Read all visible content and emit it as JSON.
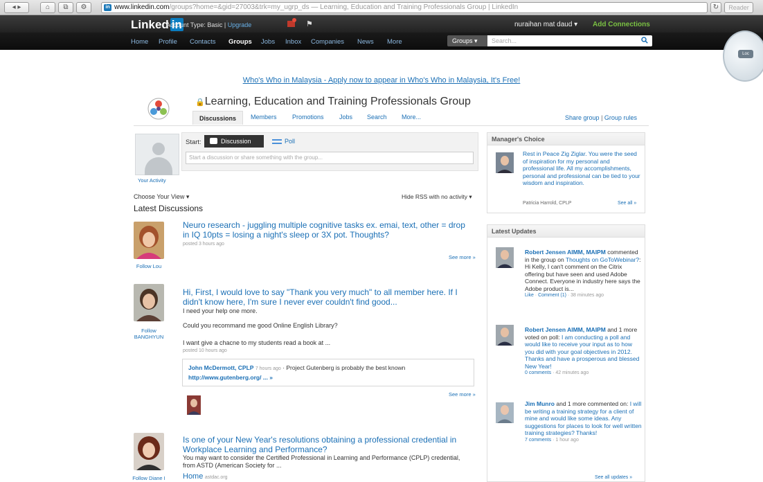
{
  "browser": {
    "url_domain": "www.linkedin.com",
    "url_rest": "/groups?home=&gid=27003&trk=my_ugrp_ds — Learning, Education and Training Professionals Group | LinkedIn",
    "reader_label": "Reader"
  },
  "header": {
    "logo_text": "Linked",
    "logo_in": "in",
    "account_type": "Account Type: Basic",
    "upgrade": "Upgrade",
    "user_name": "nuraihan mat daud ▾",
    "add_connections": "Add Connections",
    "nav": [
      "Home",
      "Profile",
      "Contacts",
      "Groups",
      "Jobs",
      "Inbox",
      "Companies",
      "News",
      "More"
    ],
    "search_scope": "Groups ▾",
    "search_placeholder": "Search..."
  },
  "magnifier_label": "Loc",
  "promo": "Who's Who in Malaysia - Apply now to appear in Who's Who in Malaysia, It's Free!",
  "group": {
    "title": "Learning, Education and Training Professionals Group",
    "tabs": [
      "Discussions",
      "Members",
      "Promotions",
      "Jobs",
      "Search",
      "More..."
    ],
    "share": "Share group",
    "rules": "Group rules"
  },
  "composer": {
    "your_activity": "Your Activity",
    "start": "Start:",
    "discussion": "Discussion",
    "poll": "Poll",
    "placeholder": "Start a discussion or share something with the group..."
  },
  "list": {
    "choose_view": "Choose Your View ▾",
    "hide_rss": "Hide RSS with no activity ▾",
    "heading": "Latest Discussions"
  },
  "discussions": [
    {
      "follow": "Follow Lou",
      "title": "Neuro research - juggling multiple cognitive tasks ex. emai, text, other = drop in IQ 10pts = losing a night's sleep or 3X pot. Thoughts?",
      "meta": "posted 3 hours ago",
      "see_more": "See more »"
    },
    {
      "follow": "Follow BANGHYUN",
      "title": "Hi, First, I would love to say \"Thank you very much\" to all member here. If I didn't know here, I'm sure I never ever couldn't find good...",
      "body1": "I need your help one more.",
      "body2": "Could you recommand me good Online English Library?",
      "body3": "I want give a chacne to my students read a book at ...",
      "meta": "posted 10 hours ago",
      "reply_author": "John McDermott, CPLP",
      "reply_time": "7 hours ago",
      "reply_text": "· Project Gutenberg is probably the best known",
      "reply_link": "http://www.gutenberg.org/ ... »",
      "see_more": "See more »"
    },
    {
      "follow": "Follow Diane I",
      "title": "Is one of your New Year's resolutions obtaining a professional credential in Workplace Learning and Performance?",
      "body1": "You may want to consider the Certified Professional in Learning and Performance (CPLP) credential, from ASTD (American Society for ...",
      "source_title": "Home",
      "source_site": "astdac.org"
    }
  ],
  "managers_choice": {
    "heading": "Manager's Choice",
    "text": "Rest in Peace Zig Ziglar. You were the seed of inspiration for my personal and professional life. All my accomplishments, personal and professional can be tied to your wisdom and inspiration.",
    "author": "Patricia Harrold, CPLP",
    "see_all": "See all »"
  },
  "updates": {
    "heading": "Latest Updates",
    "items": [
      {
        "name": "Robert Jensen AIMM, MAIPM",
        "action": "commented in the group on",
        "link": "Thoughts on GoToWebinar?",
        "text": ": Hi Kelly, I can't comment on the Citrix offering but have seen and used Adobe Connect. Everyone in industry here says the Adobe product is...",
        "like": "Like",
        "comment": "Comment (1)",
        "time": "38 minutes ago"
      },
      {
        "name": "Robert Jensen AIMM, MAIPM",
        "action": "and 1 more voted on poll:",
        "link": "I am conducting a poll and would like to receive your input as to how you did with your goal objectives in 2012. Thanks and have a prosperous and blessed New Year!",
        "comments": "0 comments",
        "time": "42 minutes ago"
      },
      {
        "name": "Jim Munro",
        "action": "and 1 more commented on:",
        "link": "I will be writing a training strategy for a client of mine and would like some ideas. Any suggestions for places to look for well written training strategies? Thanks!",
        "comments": "7 comments",
        "time": "1 hour ago"
      }
    ],
    "see_all": "See all updates »"
  },
  "colors": {
    "link": "#1a6fb5",
    "add_connections": "#7ac142",
    "header_bg": "#1e1e1e"
  }
}
